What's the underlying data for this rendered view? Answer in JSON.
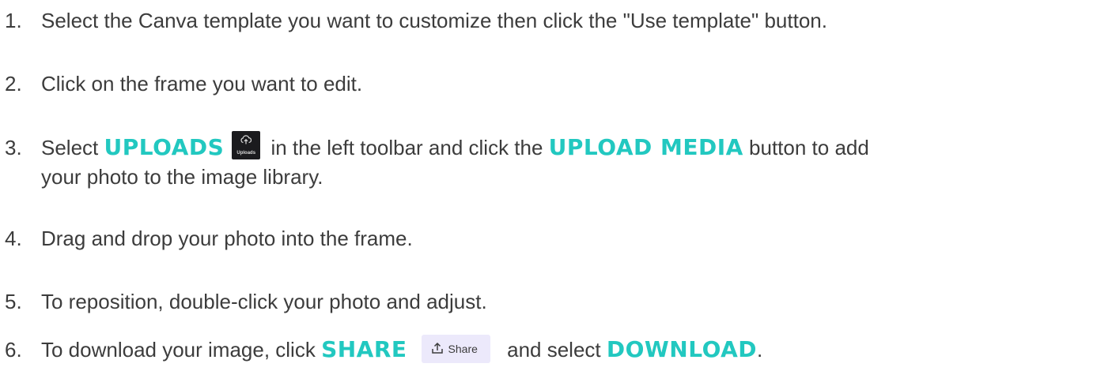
{
  "steps": [
    {
      "num": "1.",
      "text": "Select the Canva template you want to customize then click the \"Use template\" button."
    },
    {
      "num": "2.",
      "text": "Click on the frame you want to edit."
    },
    {
      "num": "3.",
      "pre": "Select ",
      "kw1": "UPLOADS",
      "icon_caption": "Uploads",
      "mid": " in the left toolbar and click the ",
      "kw2": "UPLOAD MEDIA",
      "post": " button to add",
      "line2": "your photo to the image library."
    },
    {
      "num": "4.",
      "text": "Drag and drop your photo into the frame."
    },
    {
      "num": "5.",
      "text": "To reposition, double-click your photo and adjust."
    },
    {
      "num": "6.",
      "pre": "To download your image, click ",
      "kw1": "SHARE",
      "share_label": "Share",
      "mid": " and select ",
      "kw2": "DOWNLOAD",
      "post": "."
    }
  ],
  "colors": {
    "keyword": "#22c8c0",
    "text": "#3c3c3c",
    "uploads_icon_bg": "#1b1b1e",
    "share_button_bg": "#ece9fb"
  },
  "icons": {
    "uploads": "cloud-upload-icon",
    "share": "share-upload-icon"
  }
}
